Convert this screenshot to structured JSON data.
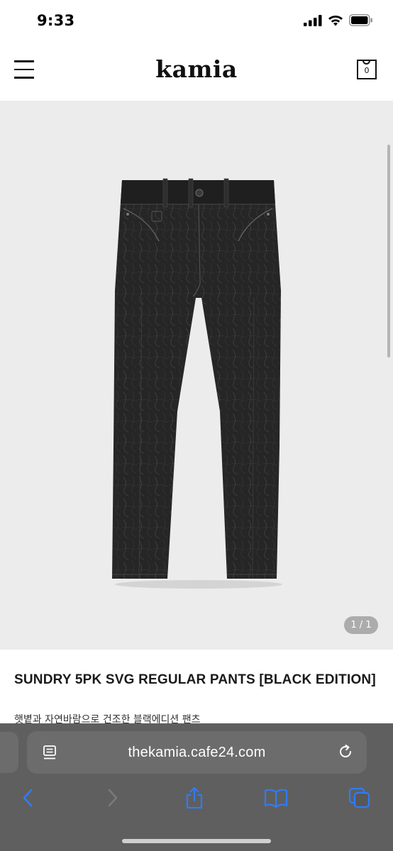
{
  "status_bar": {
    "time": "9:33"
  },
  "header": {
    "logo": "kamia",
    "cart_count": "0"
  },
  "gallery": {
    "image_alt": "black jeans",
    "page_counter": "1 / 1"
  },
  "product": {
    "title": "SUNDRY 5PK SVG REGULAR PANTS [BLACK EDITION]",
    "description": "햇볕과 자연바람으로 건조한 블랙에디션 팬츠"
  },
  "browser": {
    "url": "thekamia.cafe24.com"
  },
  "colors": {
    "accent_blue": "#2f7cf6",
    "toolbar_bg": "#585858"
  }
}
